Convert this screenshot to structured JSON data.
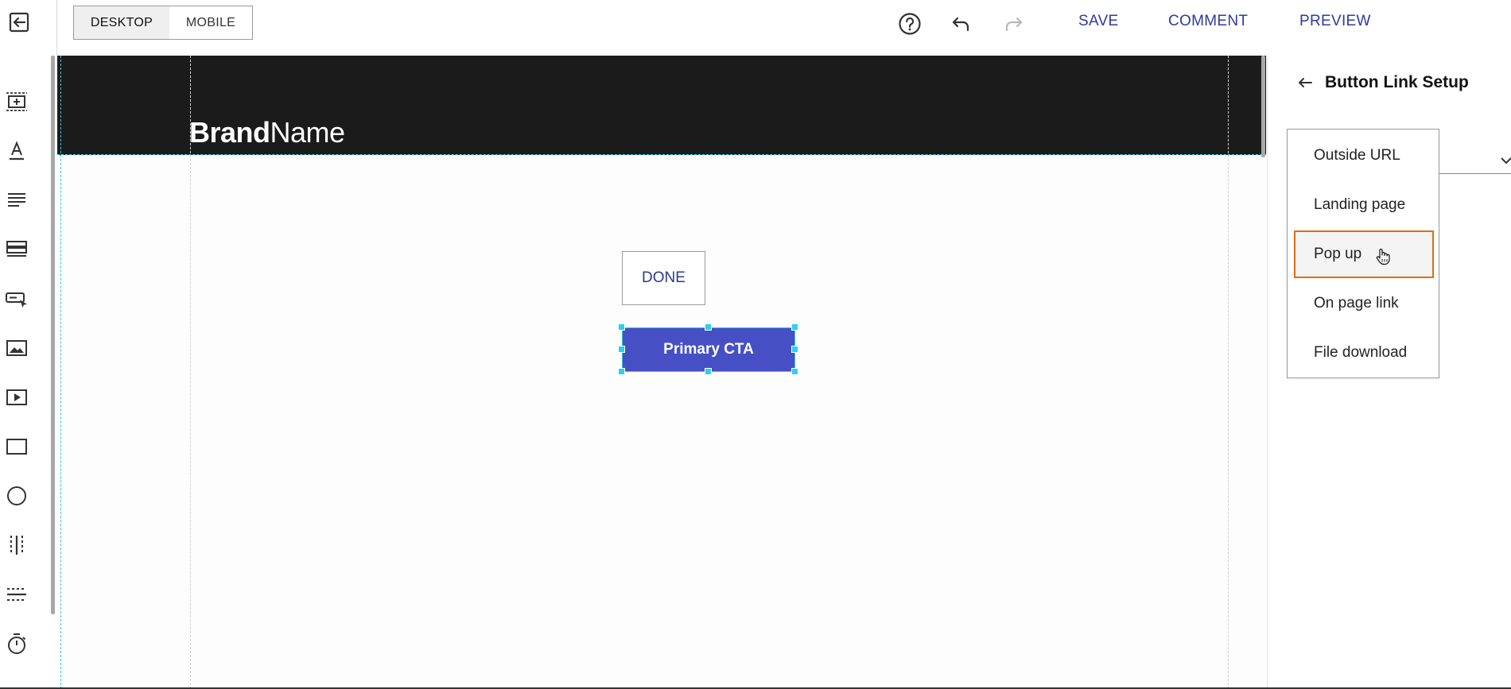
{
  "toolbar": {
    "device_toggle": {
      "desktop_label": "DESKTOP",
      "mobile_label": "MOBILE",
      "active": "desktop"
    },
    "save_label": "SAVE",
    "comment_label": "COMMENT",
    "preview_label": "PREVIEW"
  },
  "left_rail": {
    "tools": [
      "add-section-icon",
      "text-icon",
      "paragraph-icon",
      "list-icon",
      "button-icon",
      "image-icon",
      "video-icon",
      "rectangle-icon",
      "circle-icon",
      "vertical-divider-icon",
      "horizontal-divider-icon",
      "timer-icon"
    ]
  },
  "canvas": {
    "brand_bold": "Brand",
    "brand_light": "Name",
    "done_label": "DONE",
    "cta_label": "Primary CTA"
  },
  "panel": {
    "title": "Button Link Setup",
    "dropdown": {
      "options": [
        "Outside URL",
        "Landing page",
        "Pop up",
        "On page link",
        "File download"
      ],
      "hovered_index": 2
    }
  },
  "colors": {
    "accent_text": "#2f3aa0",
    "cta_fill": "#4650c4",
    "selection": "#35c6e8",
    "hover_outline": "#e06d14",
    "header_band": "#1b1b1b"
  }
}
